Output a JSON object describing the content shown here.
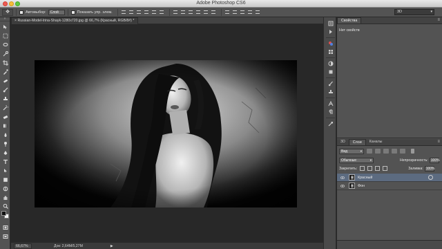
{
  "window": {
    "title": "Adobe Photoshop CS6"
  },
  "options_bar": {
    "tool_icon": "move-tool-icon",
    "auto_select_label": "Автовыбор:",
    "auto_select_value": "Слой",
    "show_controls_label": "Показать упр. элем."
  },
  "workspace": {
    "value": "3D"
  },
  "document": {
    "tab_title": "Russian-Model-Irina-Shayk-1280x720.jpg @ 66,7% (Красный, RGB/8#) *",
    "zoom": "66,67%",
    "doc_info": "Док: 2,64M/5,27M"
  },
  "properties_panel": {
    "tab_label": "Свойства",
    "empty_text": "Нет свойств"
  },
  "layers_panel": {
    "tabs": [
      "3D",
      "Слои",
      "Каналы"
    ],
    "filter_kind": "Вид",
    "blend_mode": "Обычные",
    "opacity_label": "Непрозрачность:",
    "opacity_value": "100%",
    "lock_label": "Закрепить:",
    "fill_label": "Заливка:",
    "fill_value": "100%",
    "layers": [
      {
        "name": "Красный",
        "selected": true
      },
      {
        "name": "Фон",
        "selected": false
      }
    ]
  },
  "colors": {
    "foreground": "#111111",
    "background": "#f4f4f4",
    "selection": "#5c6b80"
  }
}
